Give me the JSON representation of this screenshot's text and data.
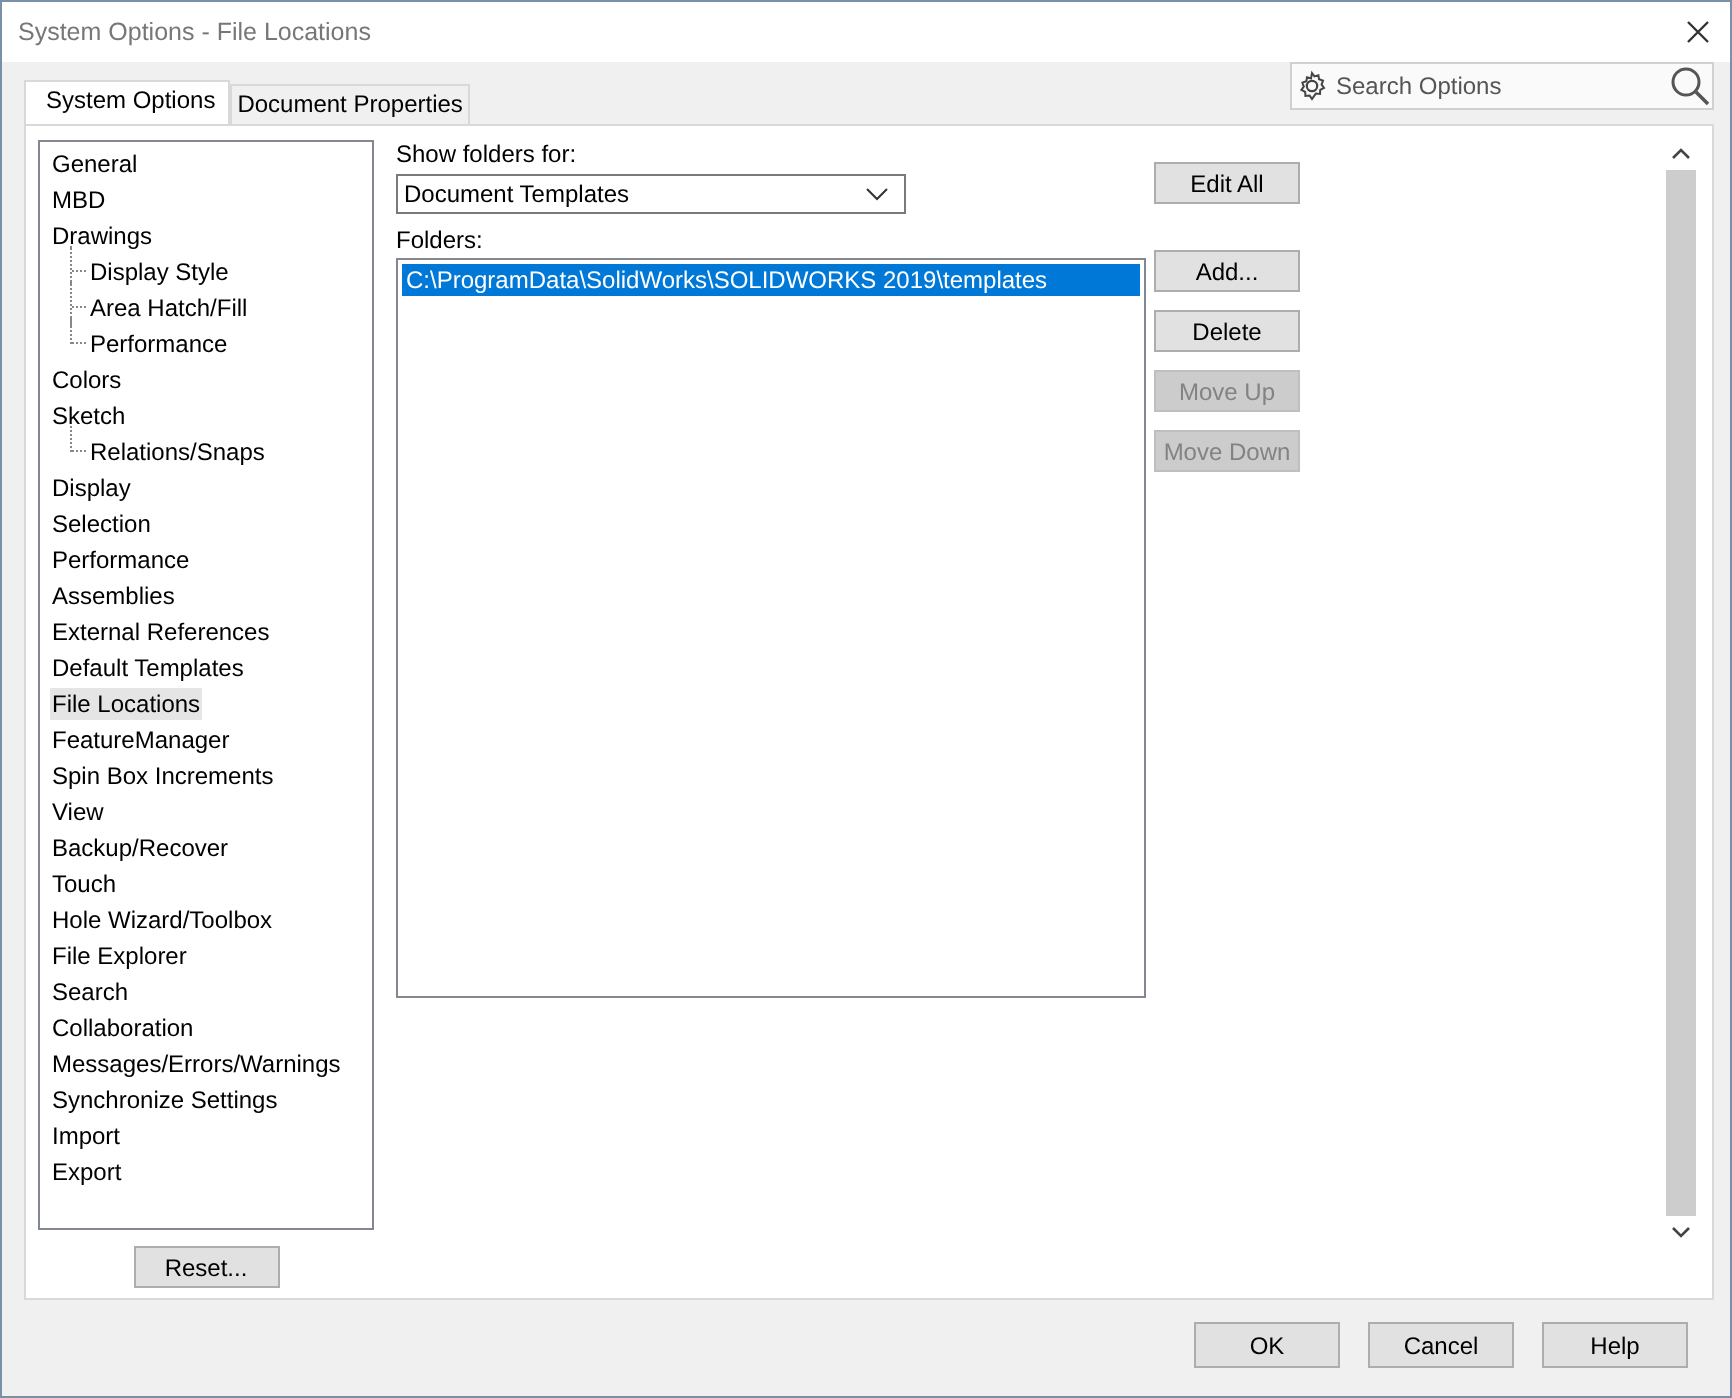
{
  "window": {
    "title": "System Options - File Locations"
  },
  "tabs": [
    {
      "label": "System Options",
      "selected": true
    },
    {
      "label": "Document Properties",
      "selected": false
    }
  ],
  "search": {
    "placeholder": "Search Options"
  },
  "sidebar": {
    "items": [
      {
        "label": "General",
        "selected": false
      },
      {
        "label": "MBD",
        "selected": false
      },
      {
        "label": "Drawings",
        "selected": false,
        "children": [
          {
            "label": "Display Style",
            "selected": false
          },
          {
            "label": "Area Hatch/Fill",
            "selected": false
          },
          {
            "label": "Performance",
            "selected": false
          }
        ]
      },
      {
        "label": "Colors",
        "selected": false
      },
      {
        "label": "Sketch",
        "selected": false,
        "children": [
          {
            "label": "Relations/Snaps",
            "selected": false
          }
        ]
      },
      {
        "label": "Display",
        "selected": false
      },
      {
        "label": "Selection",
        "selected": false
      },
      {
        "label": "Performance",
        "selected": false
      },
      {
        "label": "Assemblies",
        "selected": false
      },
      {
        "label": "External References",
        "selected": false
      },
      {
        "label": "Default Templates",
        "selected": false
      },
      {
        "label": "File Locations",
        "selected": true
      },
      {
        "label": "FeatureManager",
        "selected": false
      },
      {
        "label": "Spin Box Increments",
        "selected": false
      },
      {
        "label": "View",
        "selected": false
      },
      {
        "label": "Backup/Recover",
        "selected": false
      },
      {
        "label": "Touch",
        "selected": false
      },
      {
        "label": "Hole Wizard/Toolbox",
        "selected": false
      },
      {
        "label": "File Explorer",
        "selected": false
      },
      {
        "label": "Search",
        "selected": false
      },
      {
        "label": "Collaboration",
        "selected": false
      },
      {
        "label": "Messages/Errors/Warnings",
        "selected": false
      },
      {
        "label": "Synchronize Settings",
        "selected": false
      },
      {
        "label": "Import",
        "selected": false
      },
      {
        "label": "Export",
        "selected": false
      }
    ],
    "reset_button": "Reset..."
  },
  "show_folders_for": {
    "label": "Show folders for:",
    "value": "Document Templates"
  },
  "folders": {
    "label": "Folders:",
    "items": [
      {
        "path": "C:\\ProgramData\\SolidWorks\\SOLIDWORKS 2019\\templates",
        "selected": true
      }
    ]
  },
  "edit_all_button": "Edit All",
  "folder_buttons": [
    {
      "label": "Add...",
      "disabled": false
    },
    {
      "label": "Delete",
      "disabled": false
    },
    {
      "label": "Move Up",
      "disabled": true
    },
    {
      "label": "Move Down",
      "disabled": true
    }
  ],
  "buttons": [
    "OK",
    "Cancel",
    "Help"
  ]
}
